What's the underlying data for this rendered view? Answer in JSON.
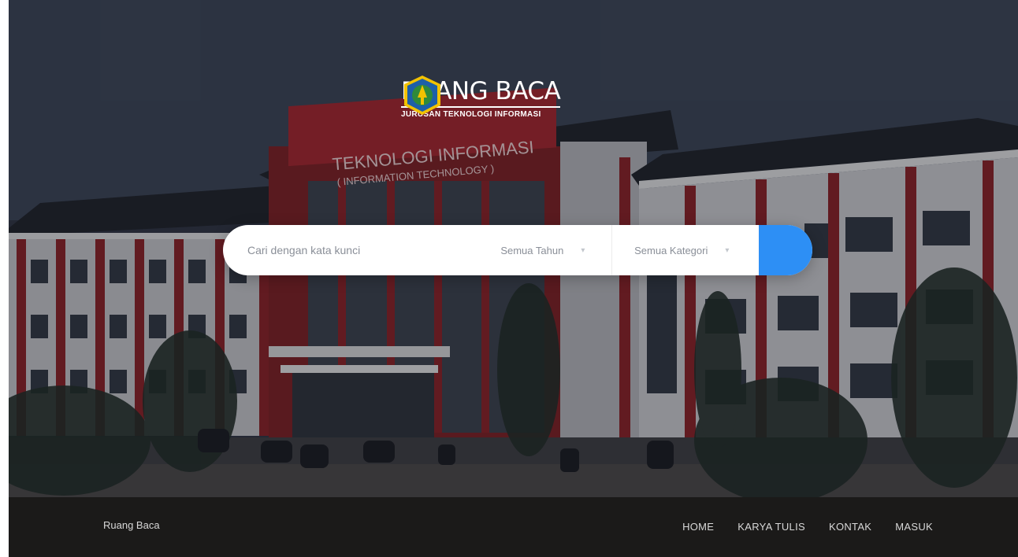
{
  "logo": {
    "title": "RUANG BACA",
    "subtitle": "JURUSAN TEKNOLOGI INFORMASI"
  },
  "building_sign": {
    "line1": "TEKNOLOGI INFORMASI",
    "line2": "( INFORMATION TECHNOLOGY )"
  },
  "search": {
    "placeholder": "Cari dengan kata kunci",
    "year_select": "Semua Tahun",
    "category_select": "Semua Kategori",
    "button_icon": "search-icon"
  },
  "footer": {
    "brand": "Ruang Baca",
    "nav": [
      "HOME",
      "KARYA TULIS",
      "KONTAK",
      "MASUK"
    ]
  },
  "colors": {
    "accent": "#2d8ff5",
    "footer_bg": "#1b1a19",
    "building_red": "#a8232a"
  }
}
